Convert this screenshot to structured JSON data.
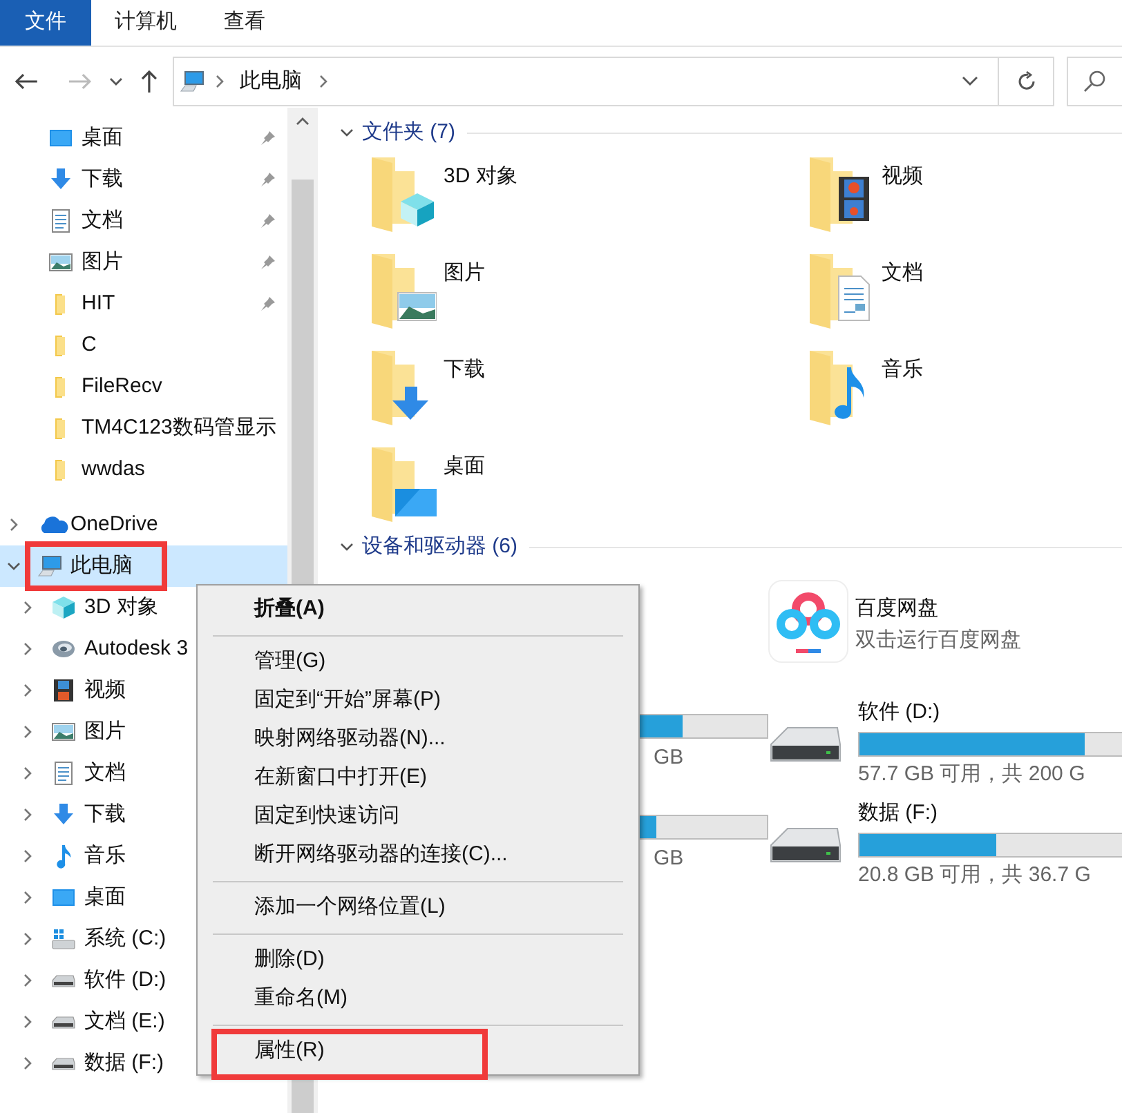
{
  "ribbon_tabs": [
    {
      "label": "文件",
      "selected": true
    },
    {
      "label": "计算机",
      "selected": false
    },
    {
      "label": "查看",
      "selected": false
    }
  ],
  "address": {
    "path": [
      "此电脑"
    ]
  },
  "navigation": {
    "quick_access": [
      {
        "label": "桌面",
        "kind": "desktop",
        "pinned": true,
        "selected": false
      },
      {
        "label": "下载",
        "kind": "download",
        "pinned": true,
        "selected": false
      },
      {
        "label": "文档",
        "kind": "document",
        "pinned": true,
        "selected": false
      },
      {
        "label": "图片",
        "kind": "picture",
        "pinned": true,
        "selected": false
      },
      {
        "label": "HIT",
        "kind": "folder",
        "pinned": true,
        "selected": false
      },
      {
        "label": "C",
        "kind": "folder",
        "pinned": false,
        "selected": false
      },
      {
        "label": "FileRecv",
        "kind": "folder",
        "pinned": false,
        "selected": false
      },
      {
        "label": "TM4C123数码管显示",
        "kind": "folder",
        "pinned": false,
        "selected": false
      },
      {
        "label": "wwdas",
        "kind": "folder",
        "pinned": false,
        "selected": false
      }
    ],
    "tree": [
      {
        "label": "OneDrive",
        "kind": "cloud",
        "expanded": false,
        "selected": false,
        "highlighted": false
      },
      {
        "label": "此电脑",
        "kind": "pc",
        "expanded": true,
        "selected": true,
        "highlighted": true,
        "children": [
          {
            "label": "3D 对象",
            "kind": "cube",
            "expanded": false,
            "selected": false
          },
          {
            "label": "Autodesk 3",
            "kind": "swirl",
            "expanded": false,
            "selected": false
          },
          {
            "label": "视频",
            "kind": "video",
            "expanded": false,
            "selected": false
          },
          {
            "label": "图片",
            "kind": "picture",
            "expanded": false,
            "selected": false
          },
          {
            "label": "文档",
            "kind": "document",
            "expanded": false,
            "selected": false
          },
          {
            "label": "下载",
            "kind": "download",
            "expanded": false,
            "selected": false
          },
          {
            "label": "音乐",
            "kind": "music",
            "expanded": false,
            "selected": false
          },
          {
            "label": "桌面",
            "kind": "desktop",
            "expanded": false,
            "selected": false
          },
          {
            "label": "系统 (C:)",
            "kind": "windrive",
            "expanded": false,
            "selected": false
          },
          {
            "label": "软件 (D:)",
            "kind": "drive",
            "expanded": false,
            "selected": false
          },
          {
            "label": "文档 (E:)",
            "kind": "drive",
            "expanded": false,
            "selected": false
          },
          {
            "label": "数据 (F:)",
            "kind": "drive",
            "expanded": false,
            "selected": false
          }
        ]
      }
    ]
  },
  "folders": {
    "title": "文件夹 (7)",
    "expanded": true,
    "items": [
      {
        "name": "3D 对象",
        "kind": "cube"
      },
      {
        "name": "视频",
        "kind": "video"
      },
      {
        "name": "图片",
        "kind": "picture"
      },
      {
        "name": "文档",
        "kind": "document"
      },
      {
        "name": "下载",
        "kind": "download"
      },
      {
        "name": "音乐",
        "kind": "music"
      },
      {
        "name": "桌面",
        "kind": "desktop"
      }
    ]
  },
  "devices": {
    "title": "设备和驱动器 (6)",
    "expanded": true,
    "left_column": [
      {
        "kind": "partial_drive",
        "level": 0.35,
        "detail": "GB"
      },
      {
        "kind": "partial_drive",
        "level": 0.15,
        "detail": "GB"
      }
    ],
    "right_column": [
      {
        "kind": "app",
        "name": "百度网盘",
        "detail": "双击运行百度网盘"
      },
      {
        "kind": "drive",
        "name": "软件 (D:)",
        "level": 0.71,
        "detail": "57.7 GB 可用，共 200 G"
      },
      {
        "kind": "drive",
        "name": "数据 (F:)",
        "level": 0.43,
        "detail": "20.8 GB 可用，共 36.7 G"
      }
    ]
  },
  "context_menu": {
    "items": [
      {
        "kind": "default",
        "label": "折叠(A)",
        "highlighted": false
      },
      {
        "kind": "separator"
      },
      {
        "kind": "item",
        "label": "管理(G)",
        "highlighted": false
      },
      {
        "kind": "item",
        "label": "固定到“开始”屏幕(P)",
        "highlighted": false
      },
      {
        "kind": "item",
        "label": "映射网络驱动器(N)...",
        "highlighted": false
      },
      {
        "kind": "item",
        "label": "在新窗口中打开(E)",
        "highlighted": false
      },
      {
        "kind": "item",
        "label": "固定到快速访问",
        "highlighted": false
      },
      {
        "kind": "item",
        "label": "断开网络驱动器的连接(C)...",
        "highlighted": false
      },
      {
        "kind": "separator"
      },
      {
        "kind": "item",
        "label": "添加一个网络位置(L)",
        "highlighted": false
      },
      {
        "kind": "separator"
      },
      {
        "kind": "item",
        "label": "删除(D)",
        "highlighted": false
      },
      {
        "kind": "item",
        "label": "重命名(M)",
        "highlighted": false
      },
      {
        "kind": "separator"
      },
      {
        "kind": "item",
        "label": "属性(R)",
        "highlighted": true
      }
    ]
  }
}
